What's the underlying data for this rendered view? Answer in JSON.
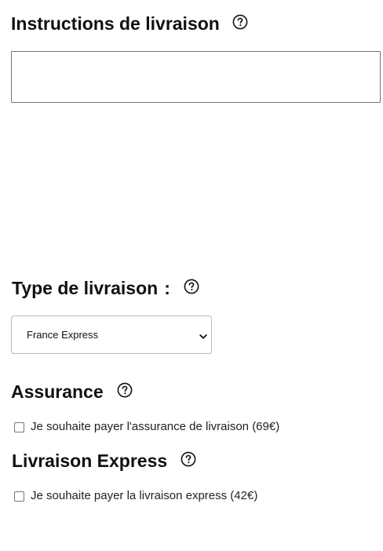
{
  "instructions": {
    "title": "Instructions de livraison",
    "help_icon": "question-circle-icon",
    "value": "",
    "placeholder": ""
  },
  "delivery_type": {
    "title": "Type de livraison",
    "colon": ":",
    "help_icon": "question-circle-icon",
    "selected": "France Express",
    "chevron_icon": "chevron-down-icon"
  },
  "insurance": {
    "title": "Assurance",
    "help_icon": "question-circle-icon",
    "checkbox_label": "Je souhaite payer l'assurance de livraison (69€)",
    "checked": false
  },
  "express": {
    "title": "Livraison Express",
    "help_icon": "question-circle-icon",
    "checkbox_label": "Je souhaite payer la livraison express (42€)",
    "checked": false
  },
  "colors": {
    "text": "#111111",
    "border": "#767676",
    "select_border": "#b8b8b8"
  }
}
